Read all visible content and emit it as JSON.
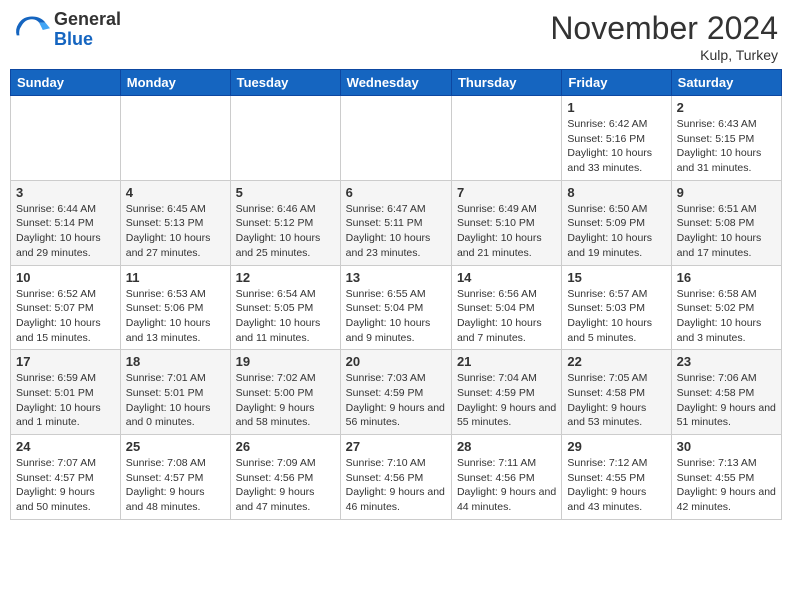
{
  "logo": {
    "general": "General",
    "blue": "Blue"
  },
  "header": {
    "month": "November 2024",
    "location": "Kulp, Turkey"
  },
  "days_of_week": [
    "Sunday",
    "Monday",
    "Tuesday",
    "Wednesday",
    "Thursday",
    "Friday",
    "Saturday"
  ],
  "weeks": [
    [
      {
        "day": "",
        "info": ""
      },
      {
        "day": "",
        "info": ""
      },
      {
        "day": "",
        "info": ""
      },
      {
        "day": "",
        "info": ""
      },
      {
        "day": "",
        "info": ""
      },
      {
        "day": "1",
        "info": "Sunrise: 6:42 AM\nSunset: 5:16 PM\nDaylight: 10 hours and 33 minutes."
      },
      {
        "day": "2",
        "info": "Sunrise: 6:43 AM\nSunset: 5:15 PM\nDaylight: 10 hours and 31 minutes."
      }
    ],
    [
      {
        "day": "3",
        "info": "Sunrise: 6:44 AM\nSunset: 5:14 PM\nDaylight: 10 hours and 29 minutes."
      },
      {
        "day": "4",
        "info": "Sunrise: 6:45 AM\nSunset: 5:13 PM\nDaylight: 10 hours and 27 minutes."
      },
      {
        "day": "5",
        "info": "Sunrise: 6:46 AM\nSunset: 5:12 PM\nDaylight: 10 hours and 25 minutes."
      },
      {
        "day": "6",
        "info": "Sunrise: 6:47 AM\nSunset: 5:11 PM\nDaylight: 10 hours and 23 minutes."
      },
      {
        "day": "7",
        "info": "Sunrise: 6:49 AM\nSunset: 5:10 PM\nDaylight: 10 hours and 21 minutes."
      },
      {
        "day": "8",
        "info": "Sunrise: 6:50 AM\nSunset: 5:09 PM\nDaylight: 10 hours and 19 minutes."
      },
      {
        "day": "9",
        "info": "Sunrise: 6:51 AM\nSunset: 5:08 PM\nDaylight: 10 hours and 17 minutes."
      }
    ],
    [
      {
        "day": "10",
        "info": "Sunrise: 6:52 AM\nSunset: 5:07 PM\nDaylight: 10 hours and 15 minutes."
      },
      {
        "day": "11",
        "info": "Sunrise: 6:53 AM\nSunset: 5:06 PM\nDaylight: 10 hours and 13 minutes."
      },
      {
        "day": "12",
        "info": "Sunrise: 6:54 AM\nSunset: 5:05 PM\nDaylight: 10 hours and 11 minutes."
      },
      {
        "day": "13",
        "info": "Sunrise: 6:55 AM\nSunset: 5:04 PM\nDaylight: 10 hours and 9 minutes."
      },
      {
        "day": "14",
        "info": "Sunrise: 6:56 AM\nSunset: 5:04 PM\nDaylight: 10 hours and 7 minutes."
      },
      {
        "day": "15",
        "info": "Sunrise: 6:57 AM\nSunset: 5:03 PM\nDaylight: 10 hours and 5 minutes."
      },
      {
        "day": "16",
        "info": "Sunrise: 6:58 AM\nSunset: 5:02 PM\nDaylight: 10 hours and 3 minutes."
      }
    ],
    [
      {
        "day": "17",
        "info": "Sunrise: 6:59 AM\nSunset: 5:01 PM\nDaylight: 10 hours and 1 minute."
      },
      {
        "day": "18",
        "info": "Sunrise: 7:01 AM\nSunset: 5:01 PM\nDaylight: 10 hours and 0 minutes."
      },
      {
        "day": "19",
        "info": "Sunrise: 7:02 AM\nSunset: 5:00 PM\nDaylight: 9 hours and 58 minutes."
      },
      {
        "day": "20",
        "info": "Sunrise: 7:03 AM\nSunset: 4:59 PM\nDaylight: 9 hours and 56 minutes."
      },
      {
        "day": "21",
        "info": "Sunrise: 7:04 AM\nSunset: 4:59 PM\nDaylight: 9 hours and 55 minutes."
      },
      {
        "day": "22",
        "info": "Sunrise: 7:05 AM\nSunset: 4:58 PM\nDaylight: 9 hours and 53 minutes."
      },
      {
        "day": "23",
        "info": "Sunrise: 7:06 AM\nSunset: 4:58 PM\nDaylight: 9 hours and 51 minutes."
      }
    ],
    [
      {
        "day": "24",
        "info": "Sunrise: 7:07 AM\nSunset: 4:57 PM\nDaylight: 9 hours and 50 minutes."
      },
      {
        "day": "25",
        "info": "Sunrise: 7:08 AM\nSunset: 4:57 PM\nDaylight: 9 hours and 48 minutes."
      },
      {
        "day": "26",
        "info": "Sunrise: 7:09 AM\nSunset: 4:56 PM\nDaylight: 9 hours and 47 minutes."
      },
      {
        "day": "27",
        "info": "Sunrise: 7:10 AM\nSunset: 4:56 PM\nDaylight: 9 hours and 46 minutes."
      },
      {
        "day": "28",
        "info": "Sunrise: 7:11 AM\nSunset: 4:56 PM\nDaylight: 9 hours and 44 minutes."
      },
      {
        "day": "29",
        "info": "Sunrise: 7:12 AM\nSunset: 4:55 PM\nDaylight: 9 hours and 43 minutes."
      },
      {
        "day": "30",
        "info": "Sunrise: 7:13 AM\nSunset: 4:55 PM\nDaylight: 9 hours and 42 minutes."
      }
    ]
  ]
}
